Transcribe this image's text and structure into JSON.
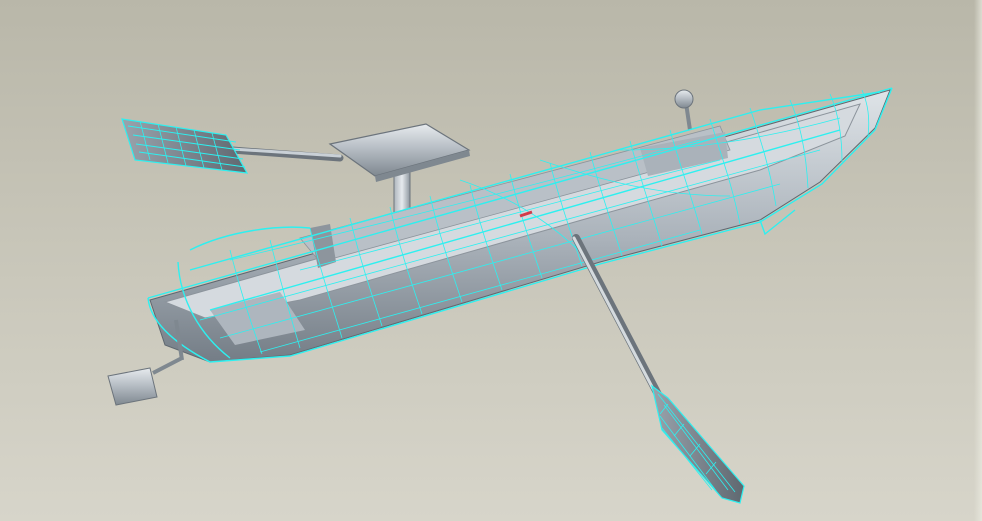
{
  "viewport": {
    "label": "",
    "background_top": "#b9b7a9",
    "background_bottom": "#d7d5ca"
  },
  "model": {
    "subject": "rowing-boat-assembly",
    "display_mode": "shaded-with-wireframe-hull",
    "colors": {
      "wireframe": "#2df0f0",
      "shaded_part": "#b8bfc6",
      "shaded_dark": "#7f8890",
      "highlight": "#eef2f5",
      "selection_marker": "#d23a4a"
    }
  }
}
